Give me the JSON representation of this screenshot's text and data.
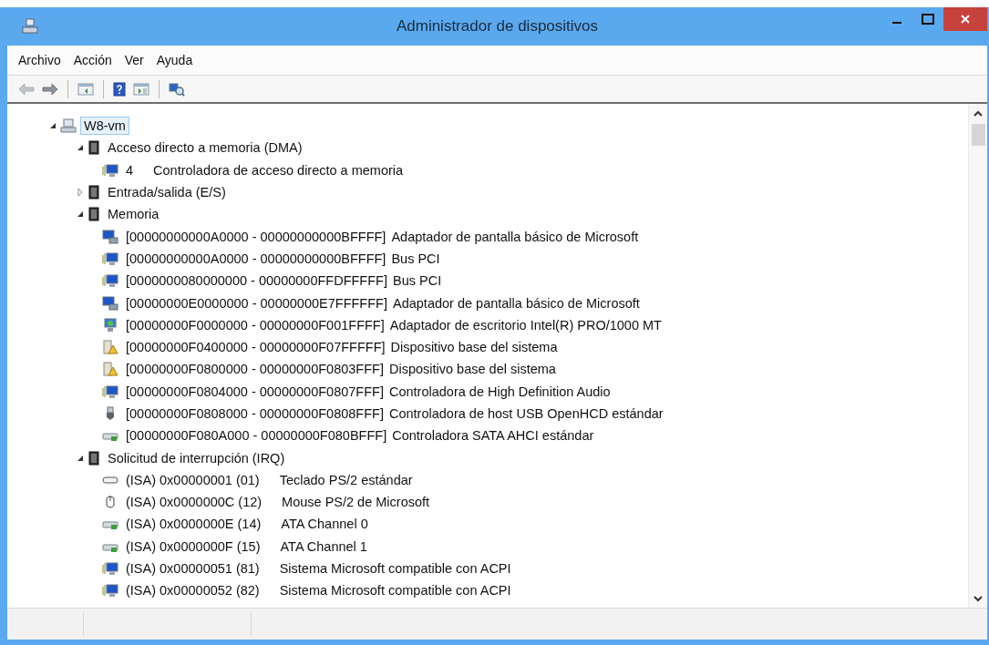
{
  "window": {
    "title": "Administrador de dispositivos"
  },
  "menu": [
    {
      "label": "Archivo"
    },
    {
      "label": "Acción"
    },
    {
      "label": "Ver"
    },
    {
      "label": "Ayuda"
    }
  ],
  "toolbar": [
    {
      "kind": "back",
      "disabled": true
    },
    {
      "kind": "forward",
      "disabled": false
    },
    {
      "kind": "separator"
    },
    {
      "kind": "console-tree",
      "disabled": false
    },
    {
      "kind": "separator"
    },
    {
      "kind": "help",
      "disabled": false
    },
    {
      "kind": "action-pane",
      "disabled": false
    },
    {
      "kind": "separator"
    },
    {
      "kind": "scan",
      "disabled": false
    }
  ],
  "tree": [
    {
      "label": "W8-vm",
      "kind": "computer",
      "expanded": true,
      "selected": true,
      "children": [
        {
          "label": "Acceso directo a memoria (DMA)",
          "kind": "category",
          "expanded": true,
          "selected": false,
          "children": [
            {
              "resource": "4",
              "name": "Controladora de acceso directo a memoria",
              "kind": "system",
              "selected": false
            }
          ]
        },
        {
          "label": "Entrada/salida (E/S)",
          "kind": "category",
          "expanded": false,
          "selected": false
        },
        {
          "label": "Memoria",
          "kind": "category",
          "expanded": true,
          "selected": false,
          "children": [
            {
              "resource": "[00000000000A0000 - 00000000000BFFFF]",
              "name": "Adaptador de pantalla básico de Microsoft",
              "kind": "display",
              "selected": false
            },
            {
              "resource": "[00000000000A0000 - 00000000000BFFFF]",
              "name": "Bus PCI",
              "kind": "system",
              "selected": false
            },
            {
              "resource": "[0000000080000000 - 00000000FFDFFFFF]",
              "name": "Bus PCI",
              "kind": "system",
              "selected": false
            },
            {
              "resource": "[00000000E0000000 - 00000000E7FFFFFF]",
              "name": "Adaptador de pantalla básico de Microsoft",
              "kind": "display",
              "selected": false
            },
            {
              "resource": "[00000000F0000000 - 00000000F001FFFF]",
              "name": "Adaptador de escritorio Intel(R) PRO/1000 MT",
              "kind": "network",
              "selected": false
            },
            {
              "resource": "[00000000F0400000 - 00000000F07FFFFF]",
              "name": "Dispositivo base del sistema",
              "kind": "warning",
              "selected": false
            },
            {
              "resource": "[00000000F0800000 - 00000000F0803FFF]",
              "name": "Dispositivo base del sistema",
              "kind": "warning",
              "selected": false
            },
            {
              "resource": "[00000000F0804000 - 00000000F0807FFF]",
              "name": "Controladora de High Definition Audio",
              "kind": "system",
              "selected": false
            },
            {
              "resource": "[00000000F0808000 - 00000000F0808FFF]",
              "name": "Controladora de host USB OpenHCD estándar",
              "kind": "usb",
              "selected": false
            },
            {
              "resource": "[00000000F080A000 - 00000000F080BFFF]",
              "name": "Controladora SATA AHCI estándar",
              "kind": "storage",
              "selected": false
            }
          ]
        },
        {
          "label": "Solicitud de interrupción (IRQ)",
          "kind": "category",
          "expanded": true,
          "selected": false,
          "children": [
            {
              "resource": "(ISA) 0x00000001 (01)",
              "name": "Teclado PS/2 estándar",
              "kind": "keyboard",
              "selected": false
            },
            {
              "resource": "(ISA) 0x0000000C (12)",
              "name": "Mouse PS/2 de Microsoft",
              "kind": "mouse",
              "selected": false
            },
            {
              "resource": "(ISA) 0x0000000E (14)",
              "name": "ATA Channel 0",
              "kind": "storage",
              "selected": false
            },
            {
              "resource": "(ISA) 0x0000000F (15)",
              "name": "ATA Channel 1",
              "kind": "storage",
              "selected": false
            },
            {
              "resource": "(ISA) 0x00000051 (81)",
              "name": "Sistema Microsoft compatible con ACPI",
              "kind": "system",
              "selected": false
            },
            {
              "resource": "(ISA) 0x00000052 (82)",
              "name": "Sistema Microsoft compatible con ACPI",
              "kind": "system",
              "selected": false
            }
          ]
        }
      ]
    }
  ]
}
